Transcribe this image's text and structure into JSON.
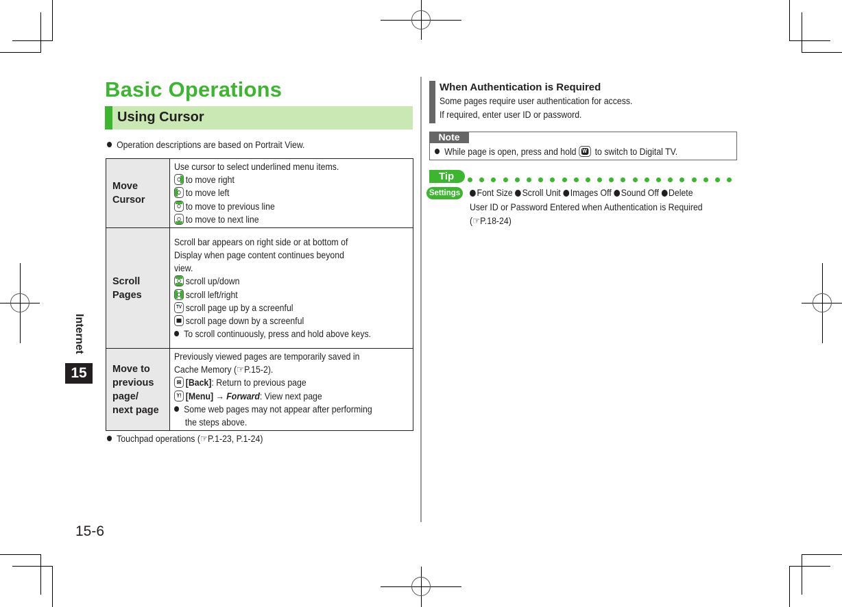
{
  "page": {
    "title": "Basic Operations",
    "section": "Using Cursor",
    "intro_bullet": "Operation descriptions are based on Portrait View.",
    "footer_bullet_prefix": "Touchpad operations (",
    "footer_bullet_ref": "P.1-23, P.1-24)",
    "page_number": "15-6",
    "chapter_label": "Internet",
    "chapter_number": "15",
    "accent_color": "#3cb52f"
  },
  "table": {
    "rows": [
      {
        "heading": "Move Cursor",
        "intro": "Use cursor to select underlined menu items.",
        "items": [
          {
            "icon": "dpad-right-key",
            "text": "to move right"
          },
          {
            "icon": "dpad-left-key",
            "text": "to move left"
          },
          {
            "icon": "dpad-up-key",
            "text": "to move to previous line"
          },
          {
            "icon": "dpad-down-key",
            "text": "to move to next line"
          }
        ]
      },
      {
        "heading": "Scroll Pages",
        "intro": [
          "Scroll bar appears on right side or at bottom of",
          "Display when page content continues beyond",
          "view."
        ],
        "items": [
          {
            "icon": "dpad-updown-key",
            "text": "scroll up/down"
          },
          {
            "icon": "dpad-leftright-key",
            "text": "scroll left/right"
          },
          {
            "icon": "tv-key",
            "text": "scroll page up by a screenful"
          },
          {
            "icon": "camera-key",
            "text": "scroll page down by a screenful"
          }
        ],
        "note": "To scroll continuously, press and hold above keys."
      },
      {
        "heading_lines": [
          "Move to",
          "previous page/",
          "next page"
        ],
        "intro_line1": "Previously viewed pages are temporarily saved in",
        "intro_line2_prefix": "Cache Memory (",
        "intro_line2_ref": "P.15-2).",
        "back_label": "[Back]",
        "back_text": ": Return to previous page",
        "menu_label": "[Menu]",
        "arrow": "→",
        "forward_label": "Forward",
        "forward_text": ": View next page",
        "note": "Some web pages may not appear after performing the steps above."
      }
    ]
  },
  "auth": {
    "title": "When Authentication is Required",
    "line1": "Some pages require user authentication for access.",
    "line2": "If required, enter user ID or password."
  },
  "note": {
    "label": "Note",
    "text_prefix": "While page is open, press and hold",
    "text_suffix": "to switch to Digital TV."
  },
  "tip": {
    "label": "Tip",
    "settings_label": "Settings",
    "items": [
      "Font Size",
      "Scroll Unit",
      "Images Off",
      "Sound Off",
      "Delete"
    ],
    "line2": "User ID or Password Entered when Authentication is Required",
    "ref": "P.18-24)",
    "ref_prefix": "("
  },
  "icons": {
    "reference": "☞"
  }
}
